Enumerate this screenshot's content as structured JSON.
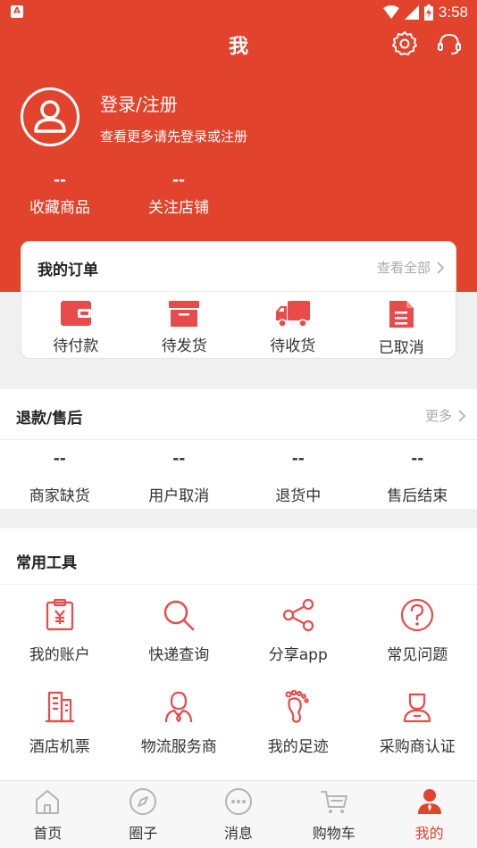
{
  "status_bar": {
    "time": "3:58",
    "notif_badge": "A"
  },
  "header": {
    "title": "我",
    "login_title": "登录/注册",
    "login_subtitle": "查看更多请先登录或注册",
    "stats": [
      {
        "value": "--",
        "label": "收藏商品"
      },
      {
        "value": "--",
        "label": "关注店铺"
      }
    ]
  },
  "orders": {
    "title": "我的订单",
    "more": "查看全部",
    "items": [
      {
        "label": "待付款",
        "icon": "wallet-icon"
      },
      {
        "label": "待发货",
        "icon": "box-icon"
      },
      {
        "label": "待收货",
        "icon": "truck-icon"
      },
      {
        "label": "已取消",
        "icon": "document-icon"
      }
    ]
  },
  "refund": {
    "title": "退款/售后",
    "more": "更多",
    "items": [
      {
        "value": "--",
        "label": "商家缺货"
      },
      {
        "value": "--",
        "label": "用户取消"
      },
      {
        "value": "--",
        "label": "退货中"
      },
      {
        "value": "--",
        "label": "售后结束"
      }
    ]
  },
  "tools": {
    "title": "常用工具",
    "items": [
      {
        "label": "我的账户",
        "icon": "yen-clipboard-icon"
      },
      {
        "label": "快递查询",
        "icon": "magnifier-icon"
      },
      {
        "label": "分享app",
        "icon": "share-icon"
      },
      {
        "label": "常见问题",
        "icon": "question-icon"
      },
      {
        "label": "酒店机票",
        "icon": "building-icon"
      },
      {
        "label": "物流服务商",
        "icon": "person-tie-icon"
      },
      {
        "label": "我的足迹",
        "icon": "footprint-icon"
      },
      {
        "label": "采购商认证",
        "icon": "user-badge-icon"
      }
    ]
  },
  "tabbar": {
    "items": [
      {
        "label": "首页",
        "icon": "home-icon"
      },
      {
        "label": "圈子",
        "icon": "compass-icon"
      },
      {
        "label": "消息",
        "icon": "message-icon"
      },
      {
        "label": "购物车",
        "icon": "cart-icon"
      },
      {
        "label": "我的",
        "icon": "profile-icon",
        "active": true
      }
    ]
  },
  "colors": {
    "brand": "#e2432d",
    "icon_red": "#e94b4b",
    "tab_inactive": "#b4b4b4"
  }
}
